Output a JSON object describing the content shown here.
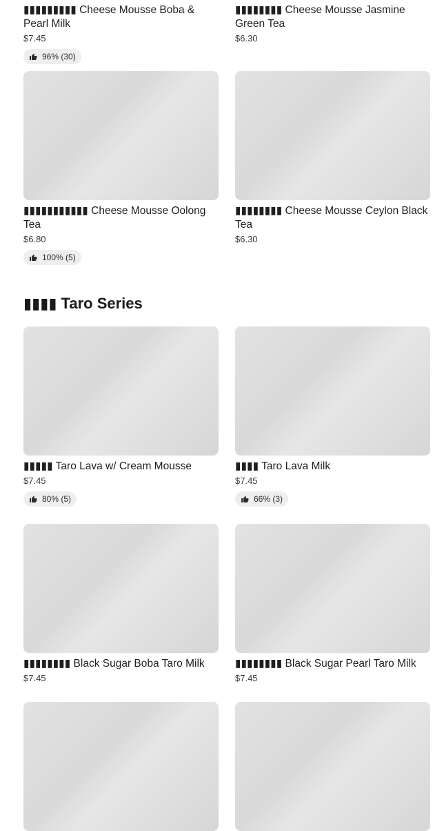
{
  "cheese_mousse": {
    "items": [
      {
        "name": "▮▮▮▮▮▮▮▮▮ Cheese Mousse Boba & Pearl Milk",
        "price": "$7.45",
        "rating": "96% (30)"
      },
      {
        "name": "▮▮▮▮▮▮▮▮ Cheese Mousse Jasmine Green Tea",
        "price": "$6.30"
      },
      {
        "name": "▮▮▮▮▮▮▮▮▮▮▮ Cheese Mousse Oolong Tea",
        "price": "$6.80",
        "rating": "100% (5)"
      },
      {
        "name": "▮▮▮▮▮▮▮▮ Cheese Mousse Ceylon Black Tea",
        "price": "$6.30"
      }
    ]
  },
  "taro_series": {
    "title": "▮▮▮▮ Taro Series",
    "items": [
      {
        "name": "▮▮▮▮▮ Taro Lava w/ Cream Mousse",
        "price": "$7.45",
        "rating": "80% (5)"
      },
      {
        "name": "▮▮▮▮ Taro Lava Milk",
        "price": "$7.45",
        "rating": "66% (3)"
      },
      {
        "name": "▮▮▮▮▮▮▮▮ Black Sugar Boba Taro Milk",
        "price": "$7.45"
      },
      {
        "name": "▮▮▮▮▮▮▮▮ Black Sugar Pearl Taro Milk",
        "price": "$7.45"
      }
    ]
  },
  "icons": {
    "rating": "thumbs-up-icon"
  },
  "colors": {
    "image_placeholder": "#dddddd",
    "rating_badge": "#eeeeee",
    "text": "#1f1f1f"
  }
}
